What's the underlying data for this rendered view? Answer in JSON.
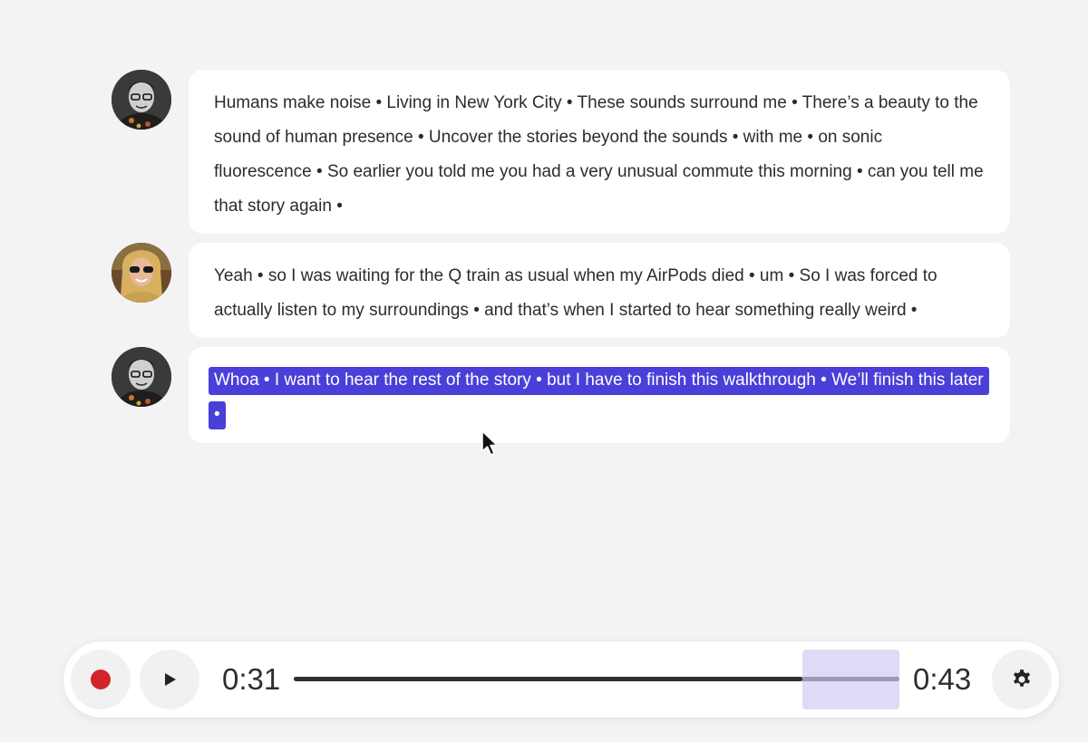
{
  "messages": [
    {
      "speaker": "host",
      "text": "Humans make noise • Living in New York City • These sounds surround me • There’s a beauty to the sound of human presence • Uncover the stories beyond the sounds • with me • on sonic fluorescence • So earlier you told me you had a very unusual commute this morning • can you tell me that story again •"
    },
    {
      "speaker": "guest",
      "text": "Yeah • so I was waiting for the Q train as usual when my AirPods died • um • So I was forced to actually listen to my surroundings • and that’s when I started to hear something really weird •"
    },
    {
      "speaker": "host",
      "text": "Whoa • I want to hear the rest of the story • but I have to finish this walkthrough • We’ll finish this later •",
      "selected": true
    }
  ],
  "player": {
    "record_icon": "record-icon",
    "play_icon": "play-icon",
    "settings_icon": "gear-icon",
    "current_time": "0:31",
    "total_time": "0:43",
    "progress": 0.84,
    "selection_start": 0.84,
    "selection_end": 1.0
  },
  "colors": {
    "accent": "#4a3fd8",
    "record": "#d3232b",
    "background": "#f3f3f3"
  }
}
